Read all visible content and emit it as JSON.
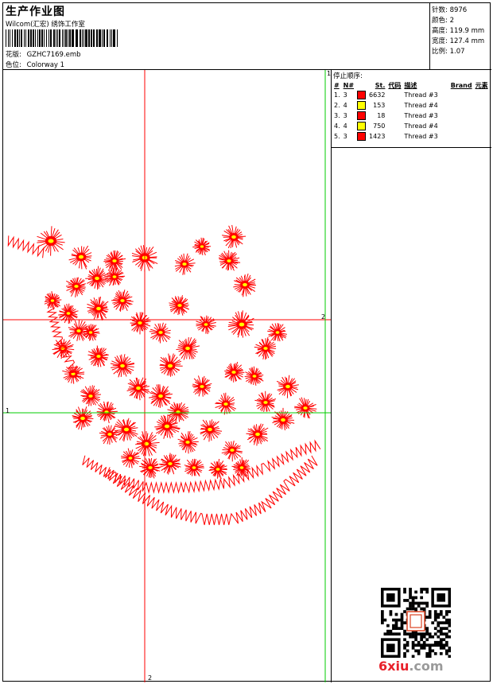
{
  "header": {
    "title": "生产作业图",
    "subtitle": "Wilcom(汇宏) 绣饰工作室",
    "design_label": "花版:",
    "design_value": "GZHC7169.emb",
    "colorway_label": "色位:",
    "colorway_value": "Colorway 1"
  },
  "stats": {
    "stitches_label": "针数:",
    "stitches": "8976",
    "colors_label": "颜色:",
    "colors": "2",
    "height_label": "高度:",
    "height": "119.9 mm",
    "width_label": "宽度:",
    "width": "127.4 mm",
    "scale_label": "比例:",
    "scale": "1.07"
  },
  "stop_sequence": {
    "title": "停止顺序:",
    "headers": [
      "#",
      "N#",
      "St.",
      "代码",
      "描述",
      "Brand",
      "元素"
    ],
    "rows": [
      {
        "index": "1.",
        "needle": "3",
        "color": "#ff0000",
        "stitches": "6632",
        "desc": "Thread #3"
      },
      {
        "index": "2.",
        "needle": "4",
        "color": "#ffff00",
        "stitches": "153",
        "desc": "Thread #4"
      },
      {
        "index": "3.",
        "needle": "3",
        "color": "#ff0000",
        "stitches": "18",
        "desc": "Thread #3"
      },
      {
        "index": "4.",
        "needle": "4",
        "color": "#ffff00",
        "stitches": "750",
        "desc": "Thread #4"
      },
      {
        "index": "5.",
        "needle": "3",
        "color": "#ff0000",
        "stitches": "1423",
        "desc": "Thread #3"
      }
    ]
  },
  "guides": {
    "red_v_label": "2",
    "red_h_label": "2",
    "green_h_label": "1",
    "green_v_label": "1"
  },
  "colors": {
    "thread_red": "#ff0000",
    "thread_yellow": "#ffff00",
    "guide_red": "#ff0000",
    "guide_green": "#00cc00",
    "watermark_gray": "#9a9a9a",
    "watermark_red": "#e8202a"
  },
  "watermark": {
    "prefix": "6xiu",
    "suffix": ".com"
  },
  "icons": {
    "qr": "qr-code-icon",
    "barcode": "barcode-icon"
  }
}
